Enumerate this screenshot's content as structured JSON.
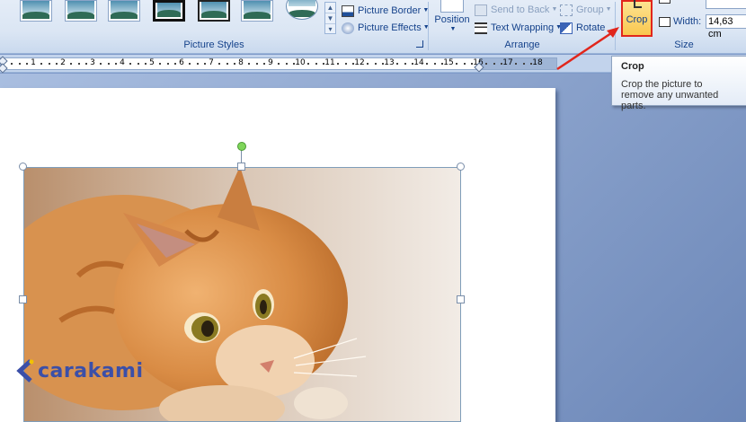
{
  "ribbon": {
    "picture_styles": {
      "label": "Picture Styles",
      "border_label": "Picture Border",
      "effects_label": "Picture Effects"
    },
    "arrange": {
      "label": "Arrange",
      "position_label": "Position",
      "send_to_back_label": "Send to Back",
      "text_wrapping_label": "Text Wrapping",
      "group_label": "Group",
      "rotate_label": "Rotate"
    },
    "size": {
      "label": "Size",
      "crop_label": "Crop",
      "width_label": "Width:",
      "width_value": "14,63 cm"
    }
  },
  "ruler": {
    "ticks": [
      "1",
      "2",
      "3",
      "4",
      "5",
      "6",
      "7",
      "8",
      "9",
      "10",
      "11",
      "12",
      "13",
      "14",
      "15",
      "16",
      "17",
      "18"
    ]
  },
  "tooltip": {
    "title": "Crop",
    "body": "Crop the picture to remove any unwanted parts."
  },
  "watermark": {
    "text": "carakami"
  },
  "colors": {
    "highlight_border": "#e1261c",
    "crop_button": "#f9c74f",
    "rotate_handle": "#7fd65a"
  }
}
